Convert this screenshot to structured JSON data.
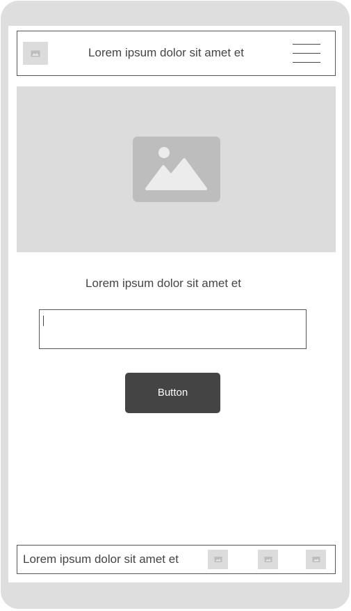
{
  "header": {
    "title": "Lorem ipsum dolor sit amet et",
    "thumbnail_icon": "image-icon",
    "menu_icon": "hamburger-menu-icon"
  },
  "hero": {
    "icon": "image-placeholder-icon"
  },
  "content": {
    "text": "Lorem ipsum dolor sit amet et",
    "input": {
      "value": "",
      "placeholder": ""
    },
    "button_label": "Button"
  },
  "footer": {
    "text": "Lorem ipsum dolor sit amet et",
    "icons": [
      "image-icon",
      "image-icon",
      "image-icon"
    ]
  },
  "colors": {
    "frame": "#dedede",
    "placeholder": "#dcdcdc",
    "button_bg": "#444444",
    "text": "#444444"
  }
}
